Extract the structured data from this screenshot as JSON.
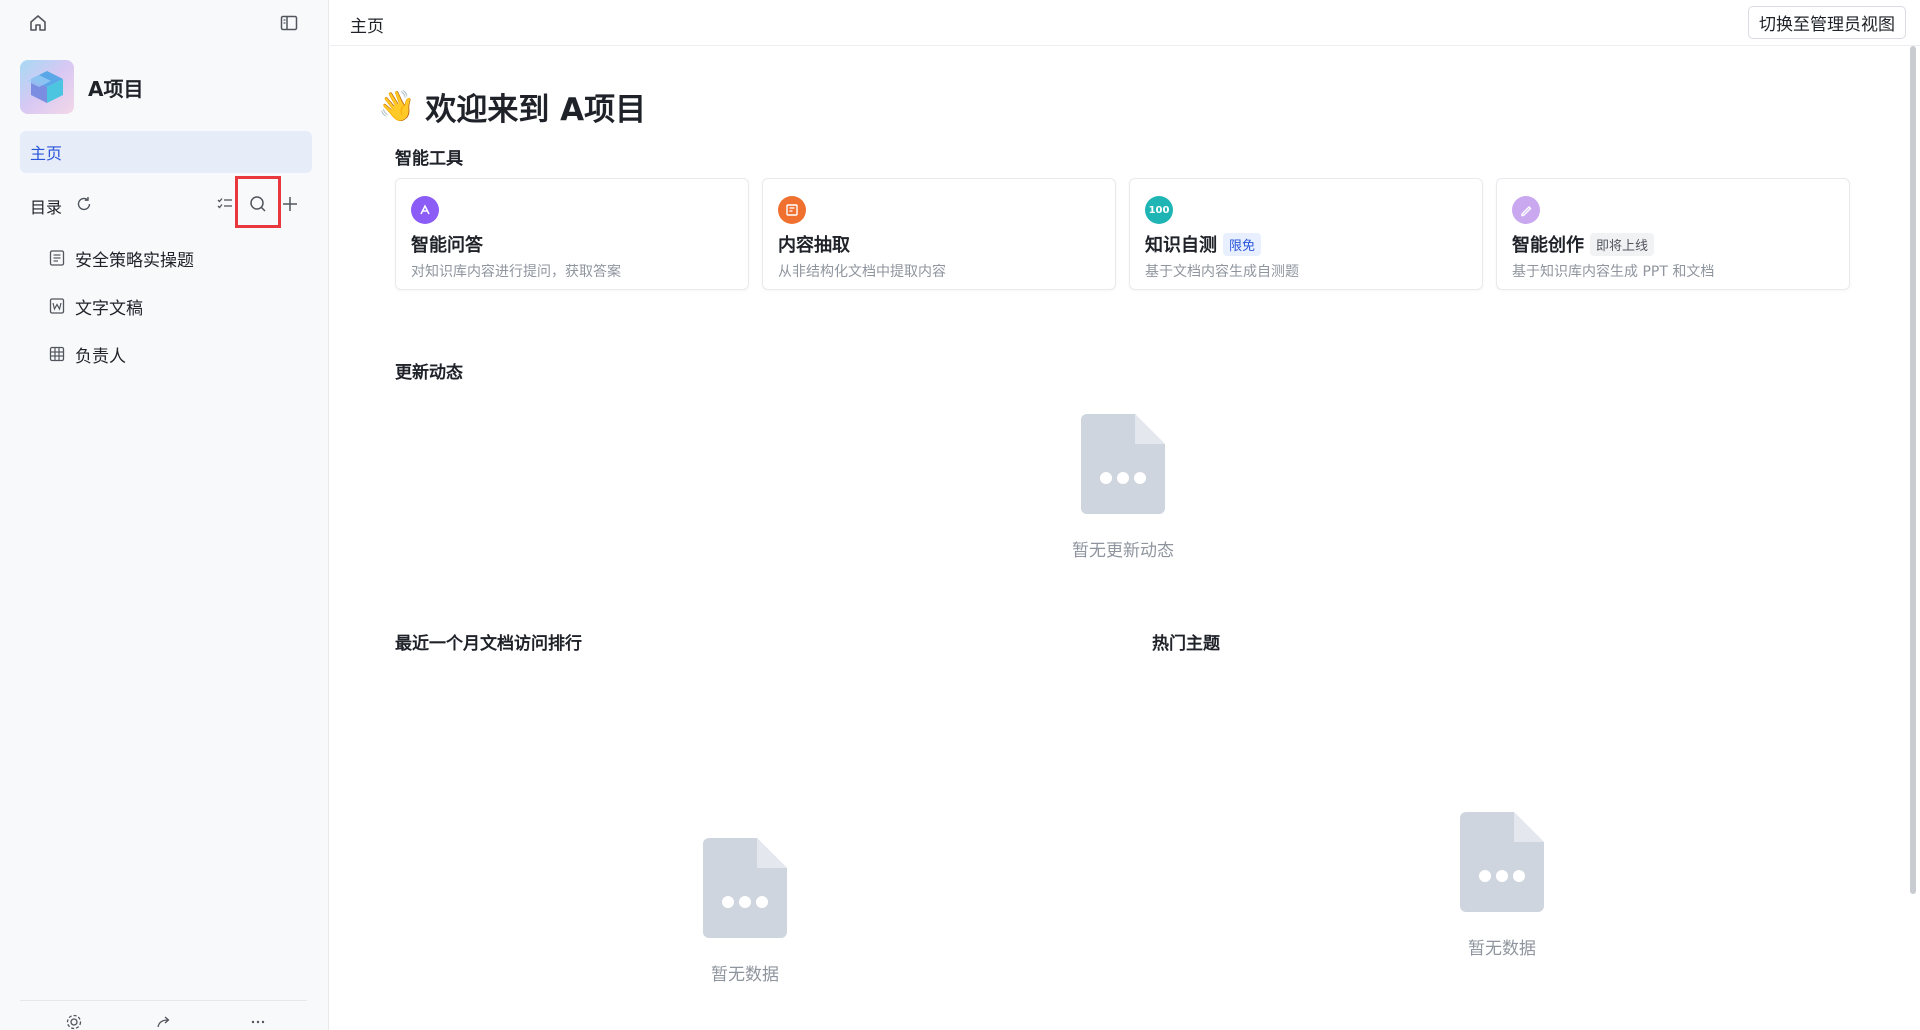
{
  "sidebar": {
    "project_name": "A项目",
    "nav_home": "主页",
    "toc_label": "目录",
    "toc_items": [
      {
        "label": "安全策略实操题",
        "icon": "document-icon"
      },
      {
        "label": "文字文稿",
        "icon": "word-doc-icon"
      },
      {
        "label": "负责人",
        "icon": "table-icon"
      }
    ],
    "highlight_color": "#e8383d"
  },
  "header": {
    "breadcrumb": "主页",
    "admin_button": "切换至管理员视图"
  },
  "main": {
    "welcome_emoji": "👋",
    "welcome_title": "欢迎来到 A项目",
    "tools_title": "智能工具",
    "tools": [
      {
        "name": "智能问答",
        "desc": "对知识库内容进行提问，获取答案",
        "color": "#8b5cf6",
        "icon": "qa-icon",
        "badge": ""
      },
      {
        "name": "内容抽取",
        "desc": "从非结构化文档中提取内容",
        "color": "#f07030",
        "icon": "extract-icon",
        "badge": ""
      },
      {
        "name": "知识自测",
        "desc": "基于文档内容生成自测题",
        "color": "#1fb5b5",
        "icon": "quiz-icon",
        "icon_text": "100",
        "badge": "限免"
      },
      {
        "name": "智能创作",
        "desc": "基于知识库内容生成 PPT 和文档",
        "color": "#c9a8f0",
        "icon": "create-icon",
        "badge": "即将上线"
      }
    ],
    "updates_title": "更新动态",
    "updates_empty": "暂无更新动态",
    "ranking_title": "最近一个月文档访问排行",
    "ranking_empty": "暂无数据",
    "topics_title": "热门主题",
    "topics_empty": "暂无数据"
  }
}
